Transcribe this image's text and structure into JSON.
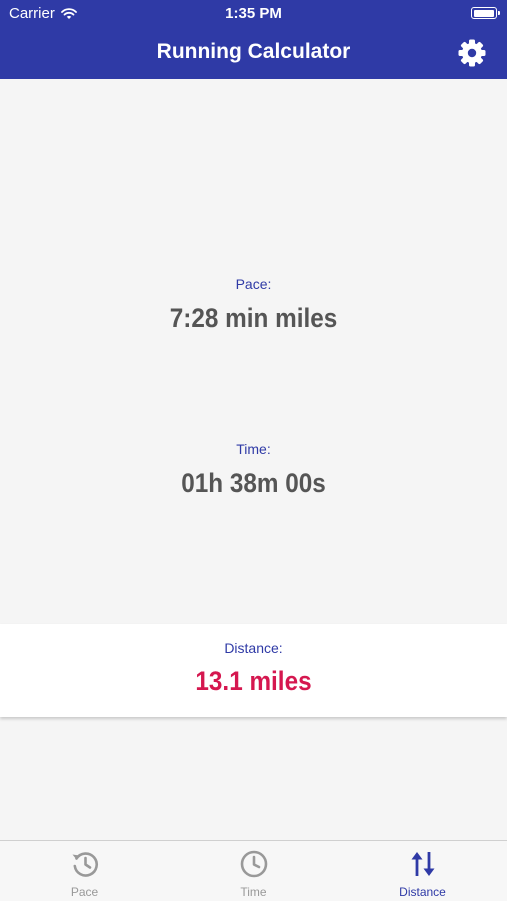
{
  "status_bar": {
    "carrier": "Carrier",
    "time": "1:35 PM",
    "battery_level": 1.0
  },
  "header": {
    "title": "Running Calculator",
    "settings_icon": "gear-icon"
  },
  "results": {
    "pace": {
      "label": "Pace:",
      "value": "7:28 min miles"
    },
    "time": {
      "label": "Time:",
      "value": "01h 38m 00s"
    },
    "distance": {
      "label": "Distance:",
      "value": "13.1 miles"
    }
  },
  "tabs": [
    {
      "label": "Pace",
      "icon": "history-icon",
      "active": false
    },
    {
      "label": "Time",
      "icon": "clock-icon",
      "active": false
    },
    {
      "label": "Distance",
      "icon": "swap-vertical-icon",
      "active": true
    }
  ],
  "colors": {
    "brand": "#2f3aa6",
    "highlight": "#d5174f",
    "value_text": "#555555",
    "inactive_tab": "#999999"
  }
}
